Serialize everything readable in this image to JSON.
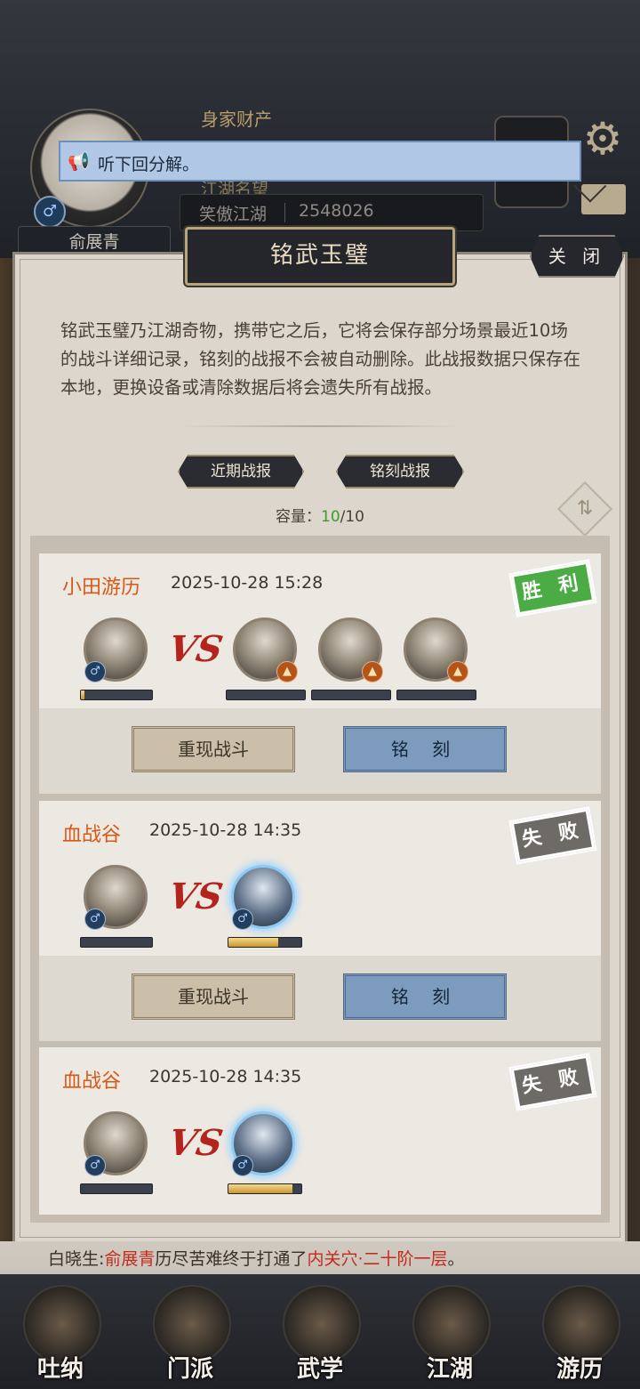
{
  "header": {
    "player_name": "俞展青",
    "gender_symbol": "♂",
    "asset_label": "身家财产",
    "fame_title": "江湖名望",
    "fame_rank": "笑傲江湖",
    "fame_score": "2548026"
  },
  "notice": {
    "icon": "megaphone-icon",
    "text": "听下回分解。"
  },
  "panel": {
    "title": "铭武玉璧",
    "close_label": "关 闭",
    "description": "铭武玉璧乃江湖奇物，携带它之后，它将会保存部分场景最近10场的战斗详细记录，铭刻的战报不会被自动删除。此战报数据只保存在本地，更换设备或清除数据后将会遗失所有战报。",
    "tabs": [
      "近期战报",
      "铭刻战报"
    ],
    "capacity_label": "容量：",
    "capacity_current": "10",
    "capacity_max": "/10"
  },
  "battles": [
    {
      "scene": "小田游历",
      "datetime": "2025-10-28 15:28",
      "result": "胜 利",
      "result_type": "win",
      "player_hp": 0.05,
      "enemies": [
        {
          "hp": 0.0,
          "badge": "fire"
        },
        {
          "hp": 0.0,
          "badge": "fire"
        },
        {
          "hp": 0.0,
          "badge": "fire"
        }
      ],
      "replay_label": "重现战斗",
      "engrave_label": "铭 刻"
    },
    {
      "scene": "血战谷",
      "datetime": "2025-10-28 14:35",
      "result": "失 败",
      "result_type": "lose",
      "player_hp": 0.0,
      "enemies": [
        {
          "hp": 0.68,
          "badge": "male"
        }
      ],
      "replay_label": "重现战斗",
      "engrave_label": "铭 刻"
    },
    {
      "scene": "血战谷",
      "datetime": "2025-10-28 14:35",
      "result": "失 败",
      "result_type": "lose",
      "player_hp": 0.0,
      "enemies": [
        {
          "hp": 0.88,
          "badge": "male"
        }
      ]
    }
  ],
  "vs_label": "VS",
  "chat": {
    "prefix": "白晓生:",
    "name": "俞展青",
    "middle": "历尽苦难终于打通了",
    "highlight": "内关穴·二十阶一层",
    "suffix": "。"
  },
  "nav": [
    "吐纳",
    "门派",
    "武学",
    "江湖",
    "游历"
  ]
}
